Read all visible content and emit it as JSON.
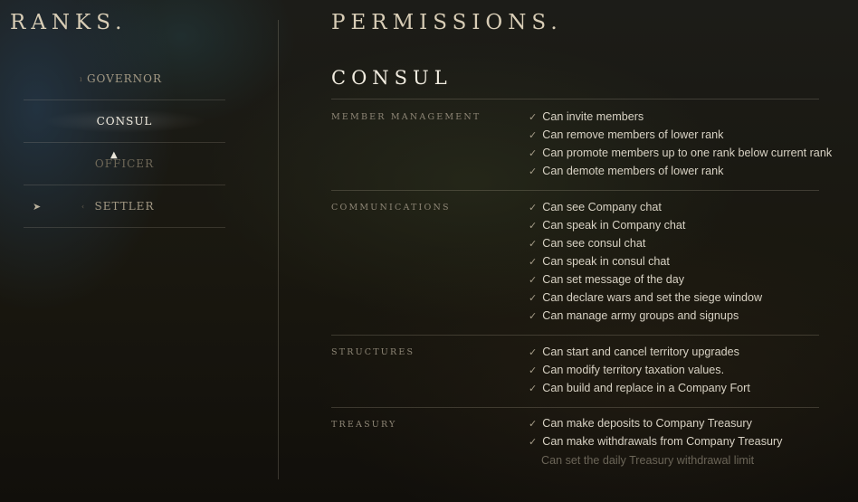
{
  "ranks": {
    "title": "RANKS.",
    "items": [
      {
        "label": "GOVERNOR"
      },
      {
        "label": "CONSUL"
      },
      {
        "label": "OFFICER"
      },
      {
        "label": "SETTLER"
      }
    ],
    "selected": "CONSUL"
  },
  "permissions": {
    "title": "PERMISSIONS.",
    "rank_name": "CONSUL",
    "check_icon": "check-icon",
    "sections": [
      {
        "label": "MEMBER MANAGEMENT",
        "items": [
          {
            "text": "Can invite members",
            "granted": true
          },
          {
            "text": "Can remove members of lower rank",
            "granted": true
          },
          {
            "text": "Can promote members up to one rank below current rank",
            "granted": true
          },
          {
            "text": "Can demote members of lower rank",
            "granted": true
          }
        ]
      },
      {
        "label": "COMMUNICATIONS",
        "items": [
          {
            "text": "Can see Company chat",
            "granted": true
          },
          {
            "text": "Can speak in Company chat",
            "granted": true
          },
          {
            "text": "Can see consul chat",
            "granted": true
          },
          {
            "text": "Can speak in consul chat",
            "granted": true
          },
          {
            "text": "Can set message of the day",
            "granted": true
          },
          {
            "text": "Can declare wars and set the siege window",
            "granted": true
          },
          {
            "text": "Can manage army groups and signups",
            "granted": true
          }
        ]
      },
      {
        "label": "STRUCTURES",
        "items": [
          {
            "text": "Can start and cancel territory upgrades",
            "granted": true
          },
          {
            "text": "Can modify territory taxation values.",
            "granted": true
          },
          {
            "text": "Can build and replace in a Company Fort",
            "granted": true
          }
        ]
      },
      {
        "label": "TREASURY",
        "items": [
          {
            "text": "Can make deposits to Company Treasury",
            "granted": true
          },
          {
            "text": "Can make withdrawals from Company Treasury",
            "granted": true
          },
          {
            "text": "Can set the daily Treasury withdrawal limit",
            "granted": false
          }
        ]
      }
    ]
  }
}
